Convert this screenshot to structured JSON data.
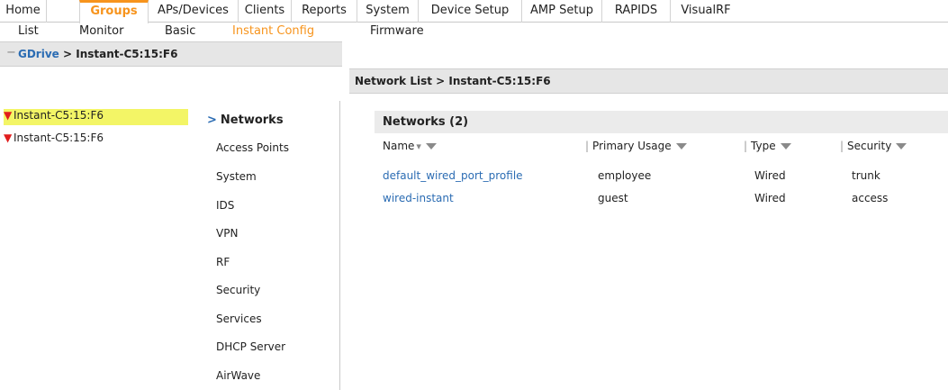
{
  "topnav": {
    "tabs": [
      "Home",
      "Groups",
      "APs/Devices",
      "Clients",
      "Reports",
      "System",
      "Device Setup",
      "AMP Setup",
      "RAPIDS",
      "VisualRF"
    ],
    "active": "Groups"
  },
  "subnav": {
    "items": [
      "List",
      "Monitor",
      "Basic",
      "Instant Config",
      "Firmware"
    ],
    "active": "Instant Config"
  },
  "left_header": {
    "collapse_symbol": "−",
    "root": "GDrive",
    "separator": " > ",
    "current": "Instant-C5:15:F6"
  },
  "tree": {
    "items": [
      "Instant-C5:15:F6",
      "Instant-C5:15:F6"
    ],
    "status_icon": "down-arrow-icon",
    "status_color": "#e11d1d",
    "selected_color": "#f3f566"
  },
  "config_menu": {
    "active": "Networks",
    "items": [
      "Networks",
      "Access Points",
      "System",
      "IDS",
      "VPN",
      "RF",
      "Security",
      "Services",
      "DHCP Server",
      "AirWave"
    ]
  },
  "main": {
    "breadcrumb": "Network List > Instant-C5:15:F6",
    "section_title": "Networks (2)",
    "columns": [
      "Name",
      "Primary Usage",
      "Type",
      "Security"
    ],
    "rows": [
      [
        "default_wired_port_profile",
        "employee",
        "Wired",
        "trunk"
      ],
      [
        "wired-instant",
        "guest",
        "Wired",
        "access"
      ]
    ]
  },
  "colors": {
    "accent": "#f7941d",
    "link": "#2b6cb3",
    "header_bg": "#e6e6e6"
  }
}
